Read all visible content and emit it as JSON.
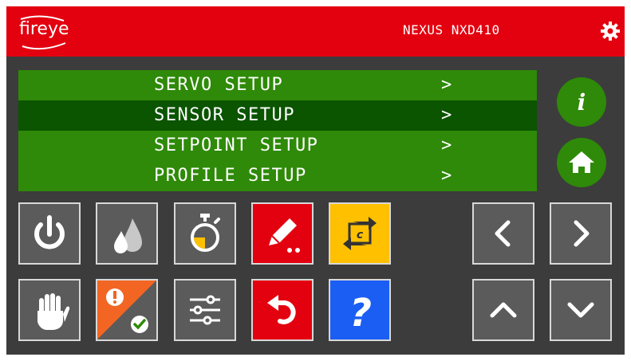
{
  "header": {
    "logo_text": "fireye",
    "model": "NEXUS NXD410",
    "settings_icon": "gear-icon"
  },
  "menu": {
    "items": [
      {
        "label": "SERVO SETUP",
        "arrow": ">"
      },
      {
        "label": "SENSOR SETUP",
        "arrow": ">"
      },
      {
        "label": "SETPOINT SETUP",
        "arrow": ">"
      },
      {
        "label": "PROFILE SETUP",
        "arrow": ">"
      }
    ],
    "selected_index": 1
  },
  "side_buttons": {
    "info_icon": "info-icon",
    "info_glyph": "i",
    "home_icon": "home-icon"
  },
  "toolbar": {
    "row1": [
      "power-icon",
      "flame-icon",
      "timer-icon",
      "edit-icon",
      "cycle-icon"
    ],
    "row2": [
      "hand-stop-icon",
      "alarm-status-icon",
      "sliders-icon",
      "undo-icon",
      "help-icon"
    ],
    "cycle_letter": "c",
    "help_glyph": "?"
  },
  "navigation": [
    "chevron-left-icon",
    "chevron-right-icon",
    "chevron-up-icon",
    "chevron-down-icon"
  ],
  "colors": {
    "header": "#e3000f",
    "background": "#3c3c3c",
    "menu_row": "#2e8a08",
    "menu_row_selected": "#0b5400",
    "tile": "#5b5b5b",
    "tile_red": "#e3000f",
    "tile_yellow": "#ffc000",
    "tile_blue": "#1b5ef3",
    "alarm_orange": "#f26522",
    "ok_green": "#2e8a08"
  }
}
